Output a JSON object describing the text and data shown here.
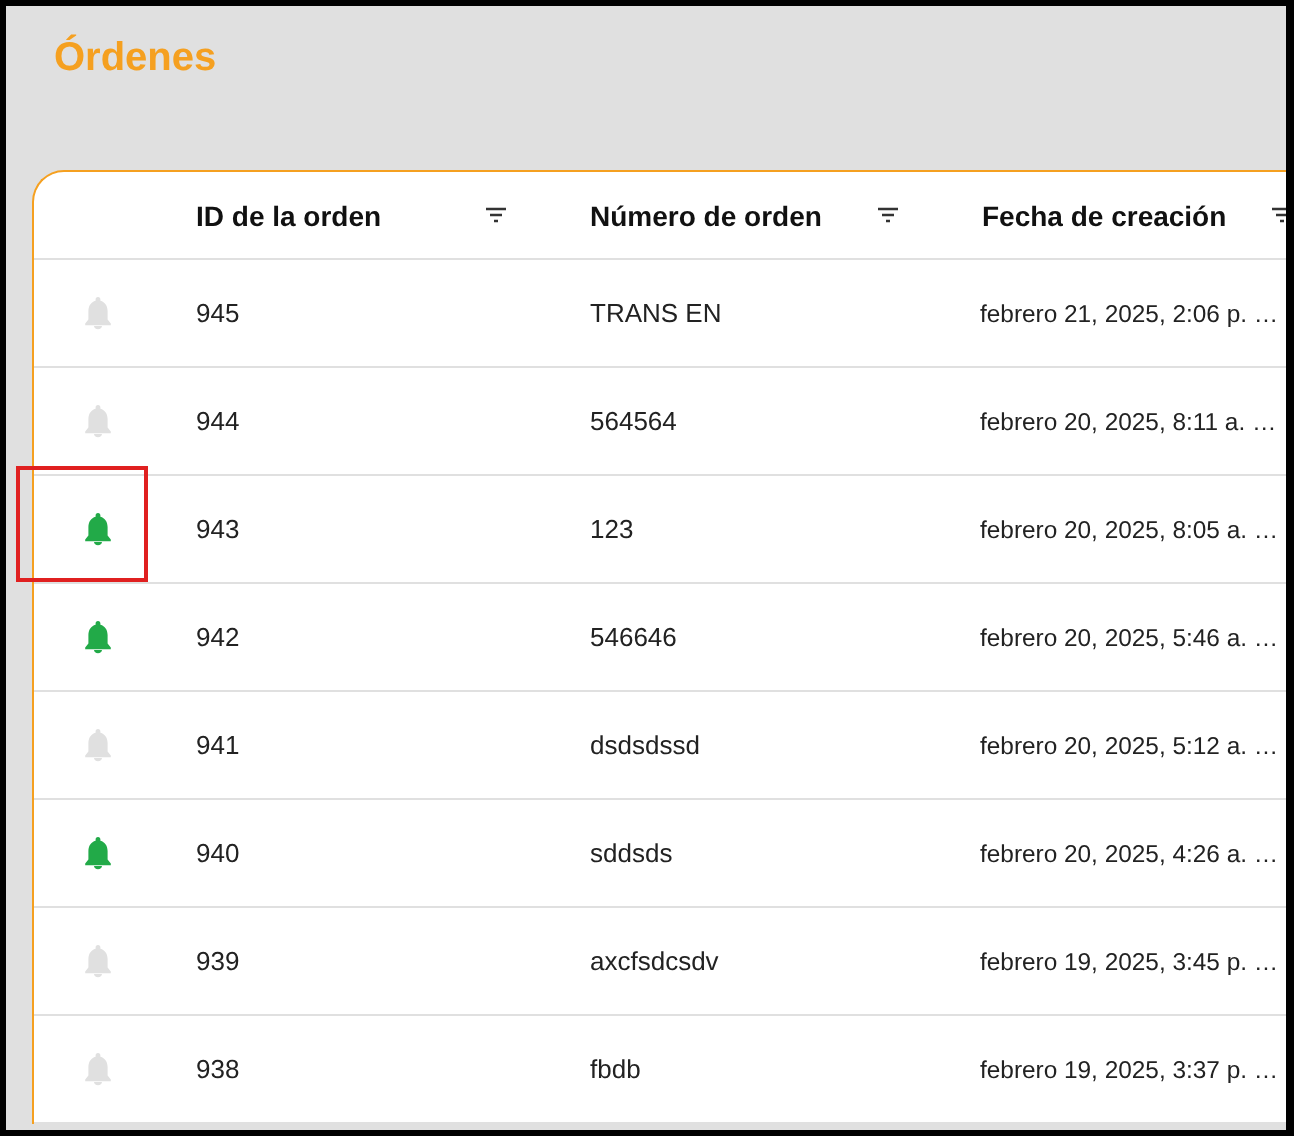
{
  "page": {
    "title": "Órdenes"
  },
  "table": {
    "columns": [
      {
        "label": "ID de la orden"
      },
      {
        "label": "Número de orden"
      },
      {
        "label": "Fecha de creación"
      }
    ],
    "rows": [
      {
        "notified": false,
        "highlighted": false,
        "id": "945",
        "number": "TRANS EN",
        "created": "febrero 21, 2025, 2:06 p. …"
      },
      {
        "notified": false,
        "highlighted": false,
        "id": "944",
        "number": "564564",
        "created": "febrero 20, 2025, 8:11 a. …"
      },
      {
        "notified": true,
        "highlighted": true,
        "id": "943",
        "number": "123",
        "created": "febrero 20, 2025, 8:05 a. …"
      },
      {
        "notified": true,
        "highlighted": false,
        "id": "942",
        "number": "546646",
        "created": "febrero 20, 2025, 5:46 a. …"
      },
      {
        "notified": false,
        "highlighted": false,
        "id": "941",
        "number": "dsdsdssd",
        "created": "febrero 20, 2025, 5:12 a. …"
      },
      {
        "notified": true,
        "highlighted": false,
        "id": "940",
        "number": "sddsds",
        "created": "febrero 20, 2025, 4:26 a. …"
      },
      {
        "notified": false,
        "highlighted": false,
        "id": "939",
        "number": "axcfsdcsdv",
        "created": "febrero 19, 2025, 3:45 p. …"
      },
      {
        "notified": false,
        "highlighted": false,
        "id": "938",
        "number": "fbdb",
        "created": "febrero 19, 2025, 3:37 p. …"
      }
    ]
  }
}
